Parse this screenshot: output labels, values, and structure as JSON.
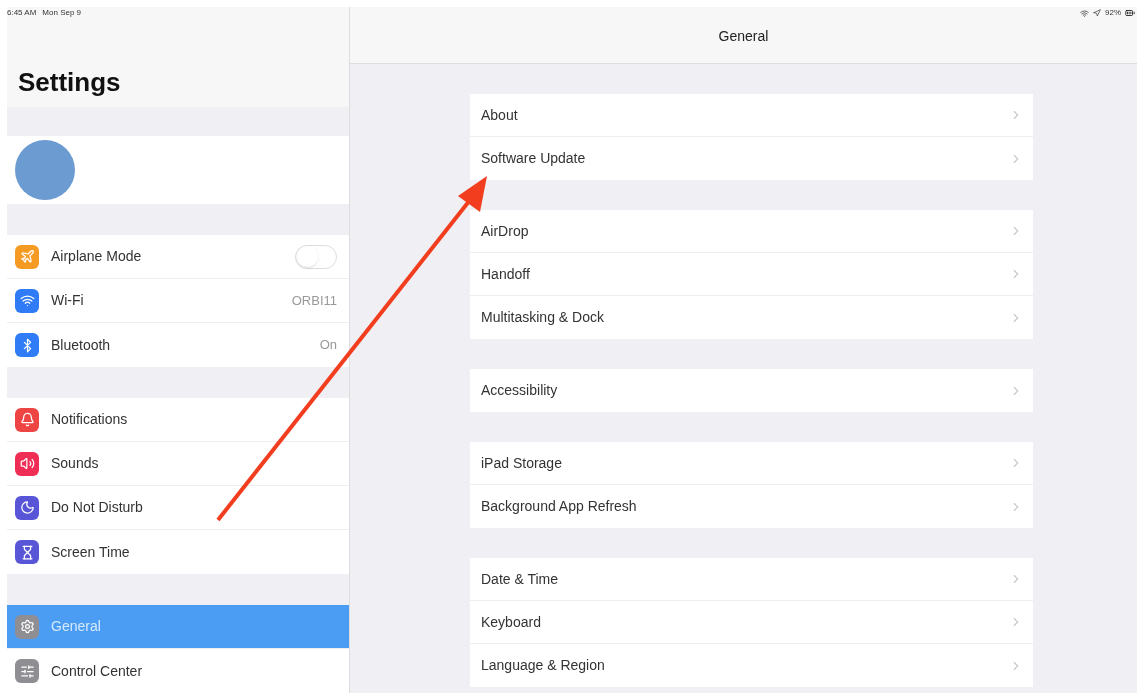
{
  "status_bar": {
    "time": "6:45 AM",
    "date": "Mon Sep 9",
    "battery": "92%"
  },
  "sidebar": {
    "title": "Settings",
    "groups": [
      [
        {
          "label": "Airplane Mode",
          "color": "#f59a23",
          "kind": "toggle",
          "on": false,
          "selected": false
        },
        {
          "label": "Wi-Fi",
          "color": "#2f7cf6",
          "kind": "value",
          "value": "ORBI11",
          "selected": false
        },
        {
          "label": "Bluetooth",
          "color": "#2f7cf6",
          "kind": "value",
          "value": "On",
          "selected": false
        }
      ],
      [
        {
          "label": "Notifications",
          "color": "#ef4444",
          "kind": "plain",
          "selected": false
        },
        {
          "label": "Sounds",
          "color": "#ef2d55",
          "kind": "plain",
          "selected": false
        },
        {
          "label": "Do Not Disturb",
          "color": "#5856d6",
          "kind": "plain",
          "selected": false
        },
        {
          "label": "Screen Time",
          "color": "#5856d6",
          "kind": "plain",
          "selected": false
        }
      ],
      [
        {
          "label": "General",
          "color": "#8e8e93",
          "kind": "plain",
          "selected": true
        },
        {
          "label": "Control Center",
          "color": "#8e8e93",
          "kind": "plain",
          "selected": false
        }
      ]
    ]
  },
  "detail": {
    "title": "General",
    "groups": [
      [
        "About",
        "Software Update"
      ],
      [
        "AirDrop",
        "Handoff",
        "Multitasking & Dock"
      ],
      [
        "Accessibility"
      ],
      [
        "iPad Storage",
        "Background App Refresh"
      ],
      [
        "Date & Time",
        "Keyboard",
        "Language & Region"
      ]
    ]
  }
}
